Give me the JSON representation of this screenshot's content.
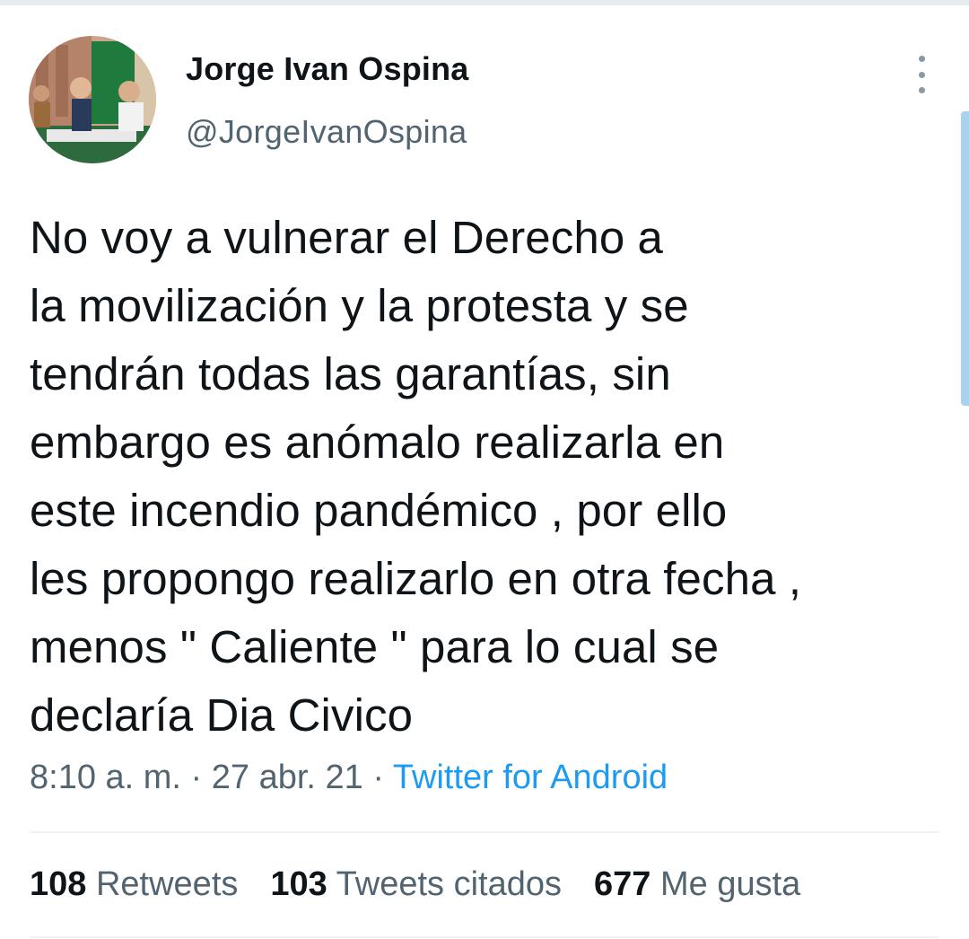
{
  "author": {
    "display_name": "Jorge Ivan Ospina",
    "handle": "@JorgeIvanOspina"
  },
  "tweet": {
    "text": "No voy a vulnerar el Derecho a\nla movilización y la protesta y se\ntendrán todas las garantías, sin\nembargo es anómalo realizarla en\neste incendio pandémico , por ello\nles propongo realizarlo en otra fecha ,\nmenos \" Caliente \" para lo cual se\ndeclaría Dia Civico",
    "time": "8:10 a. m.",
    "separator": "·",
    "date": "27 abr. 21",
    "source": "Twitter for Android"
  },
  "stats": {
    "retweets_count": "108",
    "retweets_label": "Retweets",
    "quotes_count": "103",
    "quotes_label": "Tweets citados",
    "likes_count": "677",
    "likes_label": "Me gusta"
  },
  "icons": {
    "more": "more-vertical-icon"
  },
  "colors": {
    "text": "#0f1419",
    "secondary": "#536471",
    "link": "#1d9bf0",
    "divider": "#eff3f4"
  }
}
